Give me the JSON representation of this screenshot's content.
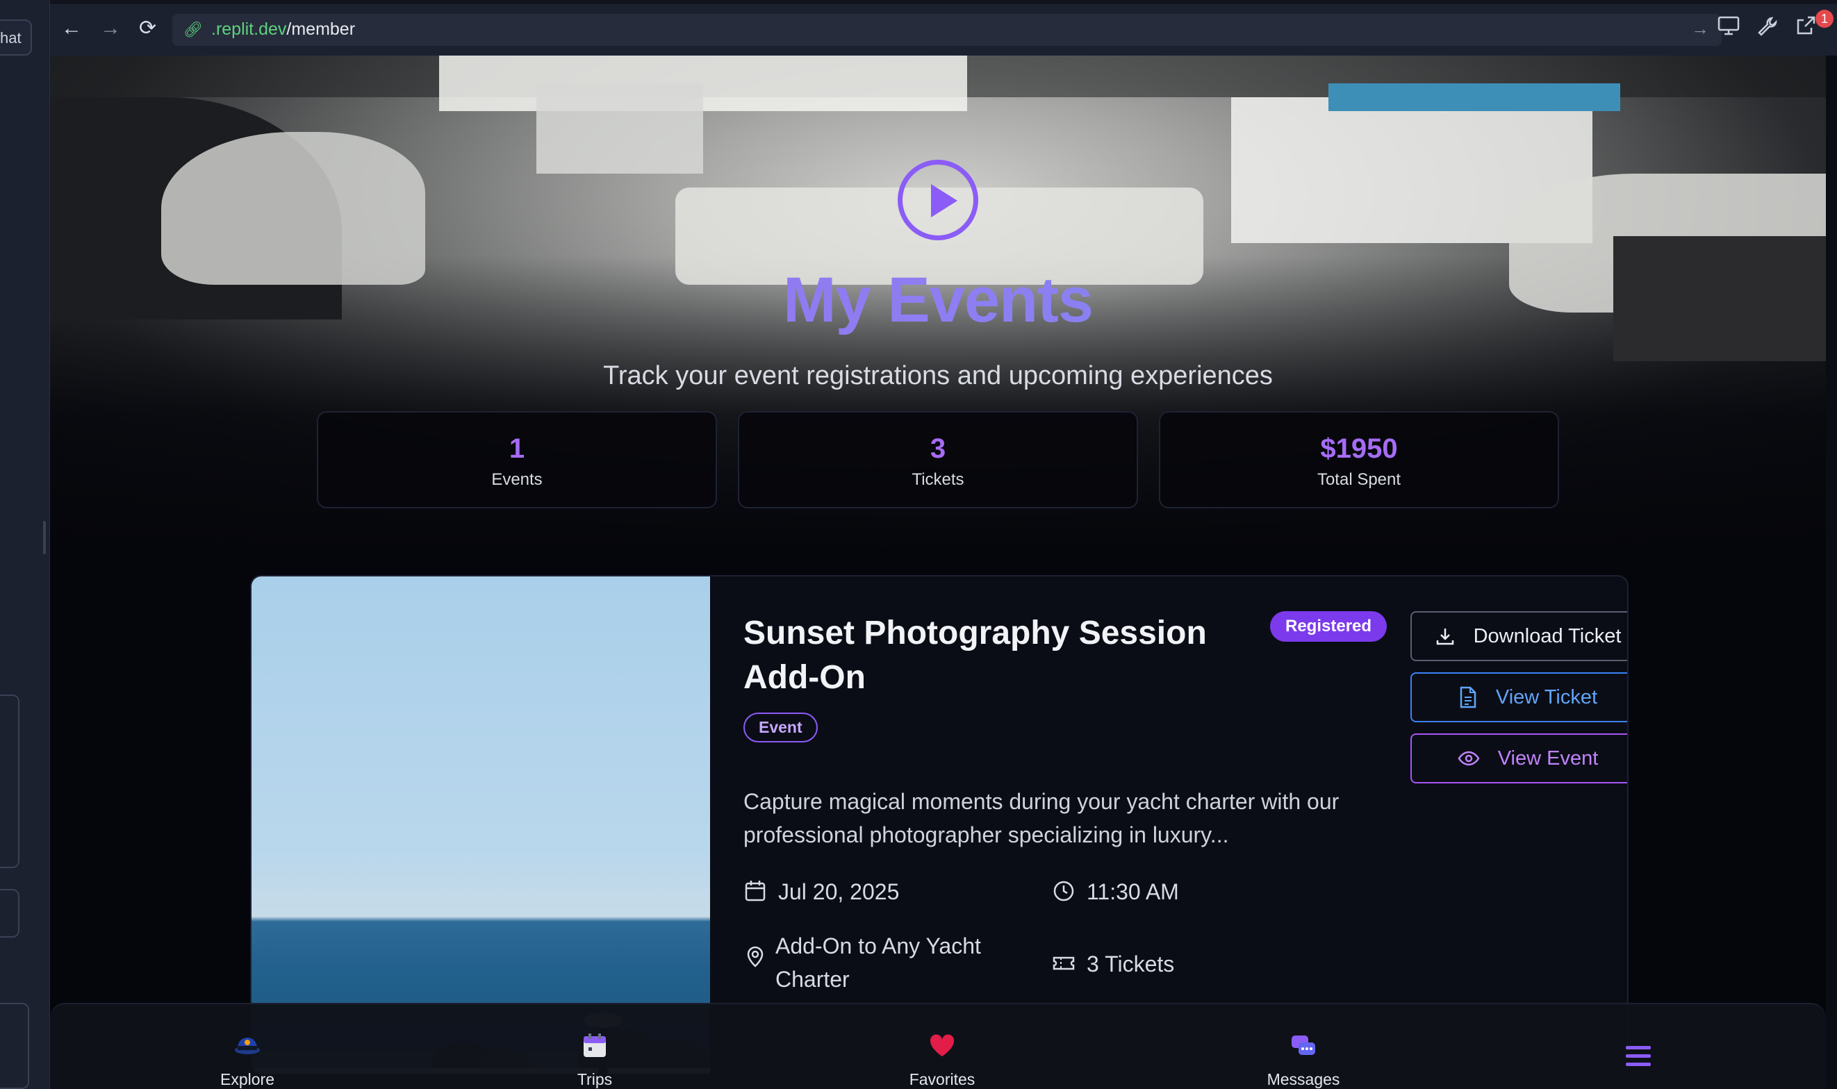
{
  "ide": {
    "tab_label": "hat"
  },
  "browser": {
    "url_host": ".replit.dev",
    "url_path": "/member",
    "notification_count": "1"
  },
  "hero": {
    "title": "My Events",
    "subtitle": "Track your event registrations and upcoming experiences"
  },
  "stats": [
    {
      "value": "1",
      "label": "Events"
    },
    {
      "value": "3",
      "label": "Tickets"
    },
    {
      "value": "$1950",
      "label": "Total Spent"
    }
  ],
  "event": {
    "title": "Sunset Photography Session Add-On",
    "status_badge": "Registered",
    "type_badge": "Event",
    "description": "Capture magical moments during your yacht charter with our professional photographer specializing in luxury...",
    "date": "Jul 20, 2025",
    "time": "11:30 AM",
    "location": "Add-On to Any Yacht Charter",
    "tickets": "3 Tickets",
    "buttons": {
      "download": "Download Ticket",
      "view_ticket": "View Ticket",
      "view_event": "View Event"
    }
  },
  "bottom_nav": [
    {
      "label": "Explore",
      "icon": "captain-hat-icon"
    },
    {
      "label": "Trips",
      "icon": "calendar-icon"
    },
    {
      "label": "Favorites",
      "icon": "heart-icon"
    },
    {
      "label": "Messages",
      "icon": "chat-bubbles-icon"
    }
  ],
  "colors": {
    "accent_purple": "#8b5cf6",
    "badge_registered": "#7c3aed",
    "view_ticket_blue": "#3b82f6",
    "url_green": "#5ed17d"
  }
}
